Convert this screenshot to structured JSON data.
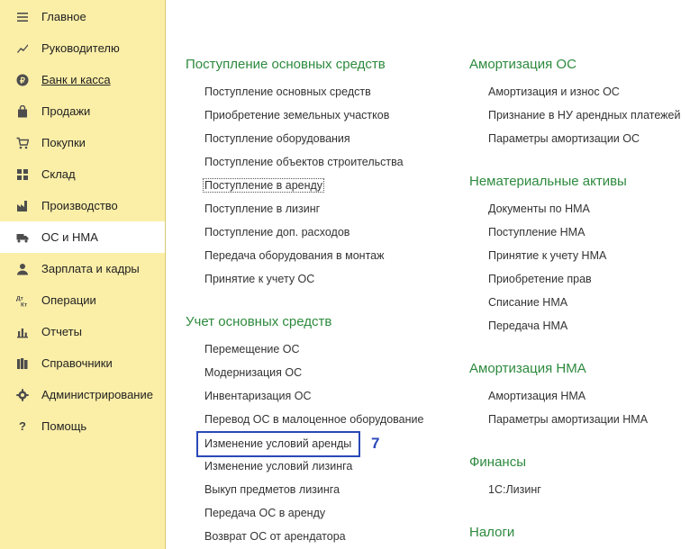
{
  "sidebar": {
    "items": [
      {
        "label": "Главное",
        "icon": "menu-lines-icon"
      },
      {
        "label": "Руководителю",
        "icon": "chart-icon"
      },
      {
        "label": "Банк и касса",
        "icon": "ruble-coin-icon"
      },
      {
        "label": "Продажи",
        "icon": "shopping-bag-icon"
      },
      {
        "label": "Покупки",
        "icon": "cart-icon"
      },
      {
        "label": "Склад",
        "icon": "warehouse-grid-icon"
      },
      {
        "label": "Производство",
        "icon": "factory-icon"
      },
      {
        "label": "ОС и НМА",
        "icon": "truck-icon",
        "active": true
      },
      {
        "label": "Зарплата и кадры",
        "icon": "people-icon"
      },
      {
        "label": "Операции",
        "icon": "dt-kt-icon"
      },
      {
        "label": "Отчеты",
        "icon": "bar-chart-icon"
      },
      {
        "label": "Справочники",
        "icon": "books-icon"
      },
      {
        "label": "Администрирование",
        "icon": "gear-icon"
      },
      {
        "label": "Помощь",
        "icon": "question-icon"
      }
    ]
  },
  "main": {
    "col1": {
      "sections": [
        {
          "title": "Поступление основных средств",
          "links": [
            "Поступление основных средств",
            "Приобретение земельных участков",
            "Поступление оборудования",
            "Поступление объектов строительства",
            "Поступление в аренду",
            "Поступление в лизинг",
            "Поступление доп. расходов",
            "Передача оборудования в монтаж",
            "Принятие к учету ОС"
          ]
        },
        {
          "title": "Учет основных средств",
          "links": [
            "Перемещение ОС",
            "Модернизация ОС",
            "Инвентаризация ОС",
            "Перевод ОС в малоценное оборудование",
            "Изменение условий аренды",
            "Изменение условий лизинга",
            "Выкуп предметов лизинга",
            "Передача ОС в аренду",
            "Возврат ОС от арендатора"
          ]
        }
      ]
    },
    "col2": {
      "sections": [
        {
          "title": "Амортизация ОС",
          "links": [
            "Амортизация и износ ОС",
            "Признание в НУ арендных платежей",
            "Параметры амортизации ОС"
          ]
        },
        {
          "title": "Нематериальные активы",
          "links": [
            "Документы по НМА",
            "Поступление НМА",
            "Принятие к учету НМА",
            "Приобретение прав",
            "Списание НМА",
            "Передача НМА"
          ]
        },
        {
          "title": "Амортизация НМА",
          "links": [
            "Амортизация НМА",
            "Параметры амортизации НМА"
          ]
        },
        {
          "title": "Финансы",
          "links": [
            "1С:Лизинг"
          ]
        },
        {
          "title": "Налоги",
          "links": []
        }
      ]
    },
    "annotation": "7"
  },
  "colors": {
    "sidebar_bg": "#fbeea7",
    "section_title": "#2d8a3e",
    "highlight": "#2a47b8"
  }
}
